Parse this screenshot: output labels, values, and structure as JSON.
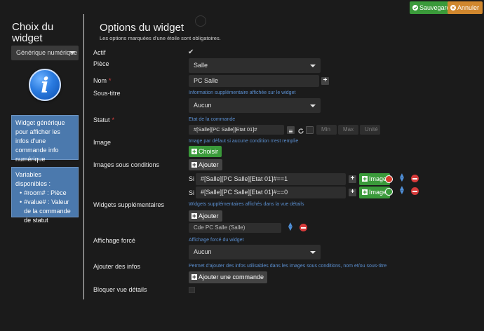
{
  "header": {
    "save_label": "Sauvegarder",
    "cancel_label": "Annuler"
  },
  "sidebar": {
    "title": "Choix du widget",
    "type_select": "Générique numérique",
    "description": "Widget générique pour afficher les infos d'une commande info numérique",
    "variables_title": "Variables disponibles :",
    "variables": [
      "#room# : Pièce",
      "#value# : Valeur de la commande de statut"
    ]
  },
  "main": {
    "title": "Options du widget",
    "subtitle": "Les options marquées d'une étoile sont obligatoires.",
    "fields": {
      "actif": {
        "label": "Actif",
        "checked": true
      },
      "piece": {
        "label": "Pièce",
        "value": "Salle"
      },
      "nom": {
        "label": "Nom",
        "value": "PC Salle"
      },
      "sous_titre": {
        "label": "Sous-titre",
        "help": "Information supplémentaire affichée sur le widget",
        "value": "Aucun"
      },
      "statut": {
        "label": "Statut",
        "help": "Etat de la commande",
        "value": "#[Salle][PC Salle][Etat 01]#",
        "min_placeholder": "Min",
        "max_placeholder": "Max",
        "unit_placeholder": "Unité"
      },
      "image": {
        "label": "Image",
        "help": "Image par défaut si aucune condition n'est remplie",
        "button": "Choisir"
      },
      "images_conditions": {
        "label": "Images sous conditions",
        "add_button": "Ajouter",
        "rows": [
          {
            "prefix": "Si",
            "condition": "#[Salle][PC Salle][Etat 01]#==1",
            "button": "Image",
            "chip_color": "#d43a2a"
          },
          {
            "prefix": "Si",
            "condition": "#[Salle][PC Salle][Etat 01]#==0",
            "button": "Image",
            "chip_color": "#3a9a3a"
          }
        ]
      },
      "widgets_supp": {
        "label": "Widgets supplémentaires",
        "help": "Widgets supplémentaires affichés dans la vue détails",
        "add_button": "Ajouter",
        "item": "Cde PC Salle (Salle)"
      },
      "affichage_force": {
        "label": "Affichage forcé",
        "help": "Affichage forcé du widget",
        "value": "Aucun"
      },
      "ajouter_infos": {
        "label": "Ajouter des infos",
        "help": "Permet d'ajouter des infos utilisables dans les images sous conditions, nom et/ou sous-titre",
        "button": "Ajouter une commande"
      },
      "bloquer": {
        "label": "Bloquer vue détails",
        "checked": false
      }
    }
  },
  "colors": {
    "background": "#1b1b1b",
    "accent_green": "#3a9a3a",
    "accent_orange": "#d0872e",
    "info_blue": "#4b79ad",
    "help_text": "#5b8fd0",
    "danger": "#d63a3a"
  }
}
